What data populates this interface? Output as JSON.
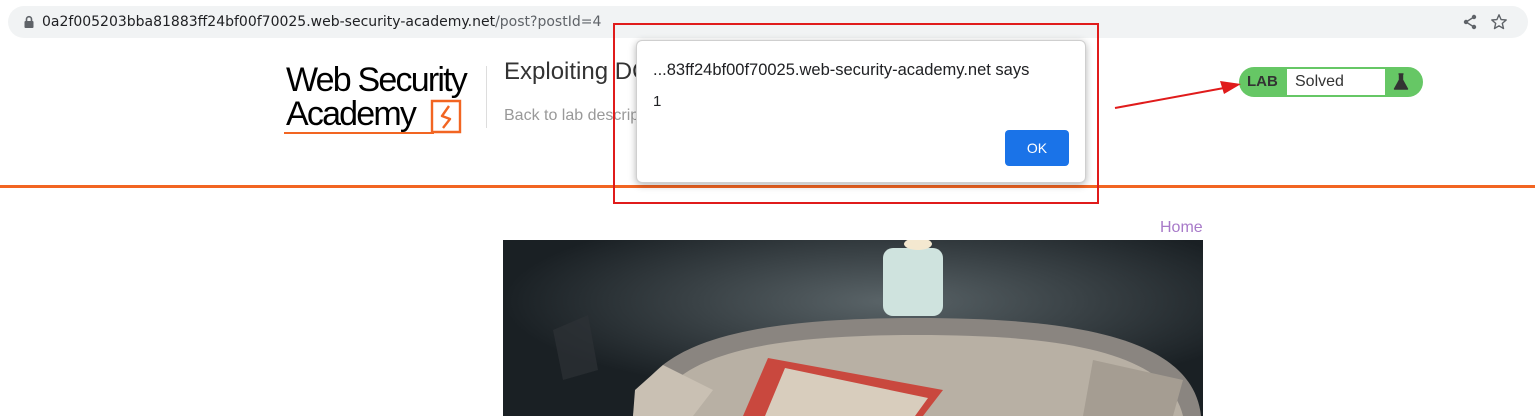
{
  "browser": {
    "url_host": "0a2f005203bba81883ff24bf00f70025.web-security-academy.net",
    "url_path": "/post?postId=4",
    "icons": [
      "lock-icon",
      "share-icon",
      "star-icon"
    ]
  },
  "header": {
    "logo_line1": "Web Security",
    "logo_line2": "Academy",
    "lab_title": "Exploiting DO",
    "back_link": "Back to lab descrip",
    "lab_badge": {
      "label": "LAB",
      "status": "Solved"
    }
  },
  "nav": {
    "home": "Home"
  },
  "dialog": {
    "origin": "...83ff24bf00f70025.web-security-academy.net says",
    "message": "1",
    "ok_label": "OK"
  },
  "colors": {
    "accent": "#f26522",
    "lab_solved": "#66c765",
    "dialog_button": "#1a73e8",
    "annotation": "#e01b1b",
    "link": "#a87ac9"
  }
}
